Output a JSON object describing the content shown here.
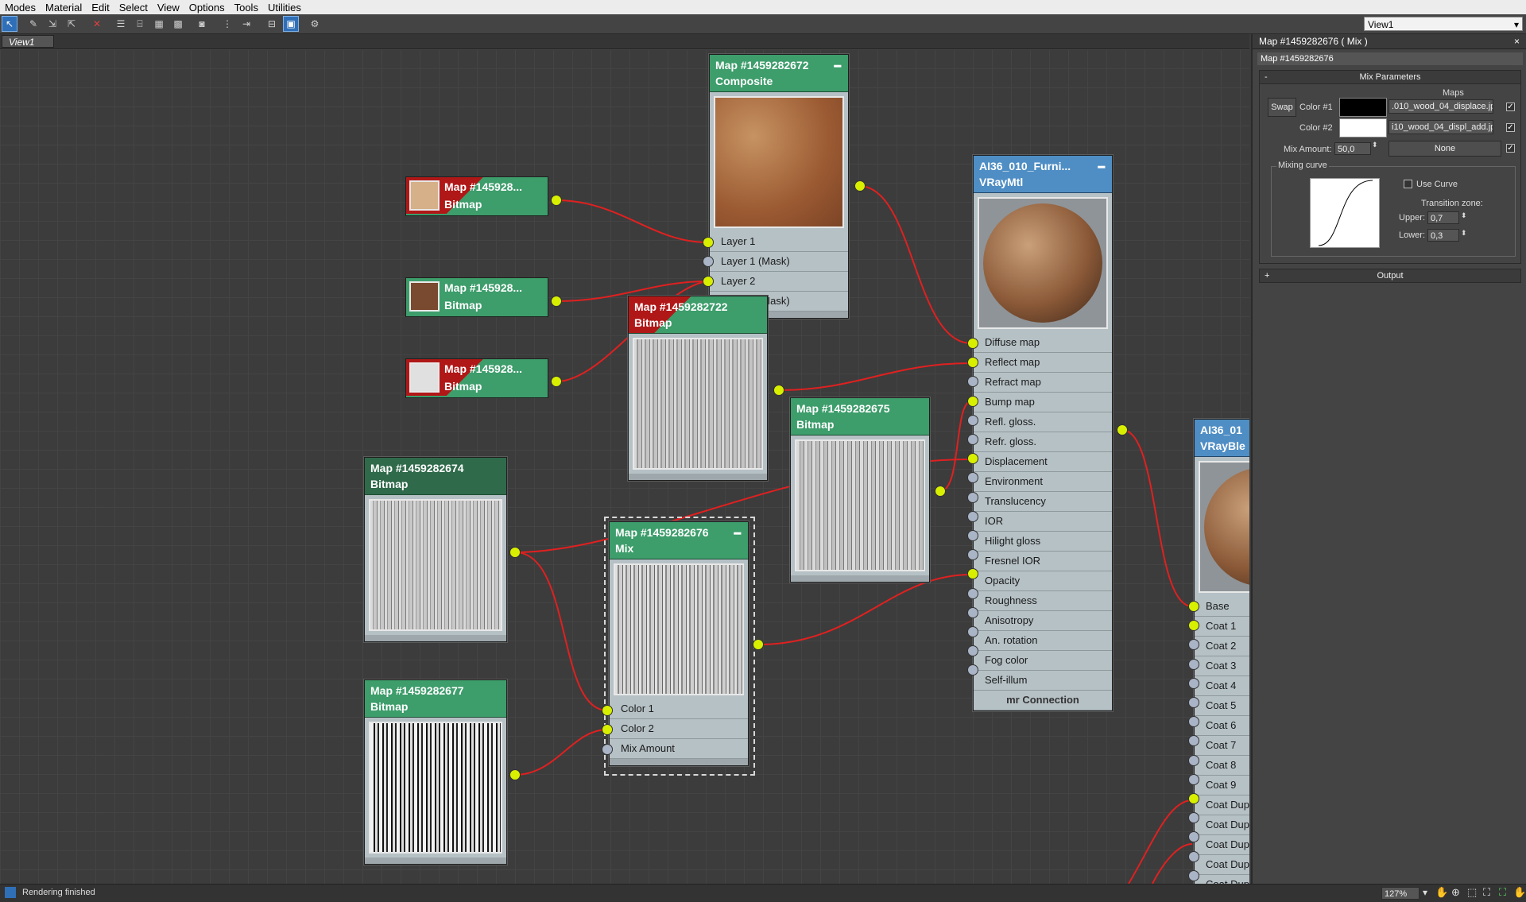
{
  "menu": [
    "Modes",
    "Material",
    "Edit",
    "Select",
    "View",
    "Options",
    "Tools",
    "Utilities"
  ],
  "toolbar": {
    "icons": [
      "select-icon",
      "paint-brush-icon",
      "assign-icon",
      "pick-material-icon",
      "delete-icon",
      "layout-icon",
      "layout-children-icon",
      "material-editor-icon",
      "show-map-icon",
      "show-background-icon",
      "show-end-result-icon",
      "move-children-icon",
      "hide-unused-icon",
      "lay-out-all-icon",
      "toggle-navigator-icon",
      "parameter-editor-icon"
    ]
  },
  "view_select": {
    "value": "View1"
  },
  "view_tab": {
    "label": "View1"
  },
  "colors": {
    "socket_on": "#d8f000",
    "wire": "#e02020",
    "node_green": "#3d9d6b",
    "node_blue": "#4f8ec4",
    "bitmap_red": "#b01818"
  },
  "nodes": {
    "composite": {
      "title": "Map #1459282672",
      "type": "Composite",
      "slots": [
        "Layer 1",
        "Layer 1 (Mask)",
        "Layer 2",
        "Layer 2 (Mask)"
      ]
    },
    "bm1": {
      "title": "Map  #145928...",
      "type": "Bitmap"
    },
    "bm2": {
      "title": "Map  #145928...",
      "type": "Bitmap"
    },
    "bm3": {
      "title": "Map  #145928...",
      "type": "Bitmap"
    },
    "bm722": {
      "title": "Map #1459282722",
      "type": "Bitmap"
    },
    "bm675": {
      "title": "Map #1459282675",
      "type": "Bitmap"
    },
    "bm674": {
      "title": "Map #1459282674",
      "type": "Bitmap"
    },
    "bm677": {
      "title": "Map #1459282677",
      "type": "Bitmap"
    },
    "mix": {
      "title": "Map #1459282676",
      "type": "Mix",
      "slots": [
        "Color 1",
        "Color 2",
        "Mix Amount"
      ]
    },
    "vraymtl": {
      "title": "AI36_010_Furni...",
      "type": "VRayMtl",
      "slots": [
        "Diffuse map",
        "Reflect map",
        "Refract map",
        "Bump map",
        "Refl. gloss.",
        "Refr. gloss.",
        "Displacement",
        "Environment",
        "Translucency",
        "IOR",
        "Hilight gloss",
        "Fresnel IOR",
        "Opacity",
        "Roughness",
        "Anisotropy",
        "An. rotation",
        "Fog color",
        "Self-illum"
      ],
      "footer": "mr Connection"
    },
    "vrayblend": {
      "title": "AI36_01",
      "type": "VRayBle",
      "slots": [
        "Base",
        "Coat 1",
        "Coat 2",
        "Coat 3",
        "Coat 4",
        "Coat 5",
        "Coat 6",
        "Coat 7",
        "Coat 8",
        "Coat 9",
        "Coat Dup",
        "Coat Dup",
        "Coat Dup",
        "Coat Dup",
        "Coat Dup"
      ]
    }
  },
  "panel": {
    "title": "Map #1459282676  ( Mix )",
    "name": "Map #1459282676",
    "mix_params": {
      "header": "Mix Parameters",
      "maps_label": "Maps",
      "swap": "Swap",
      "color1_label": "Color #1",
      "color1_map": ".010_wood_04_displace.jpg)",
      "color2_label": "Color #2",
      "color2_map": "i10_wood_04_displ_add.jpg)",
      "mix_amount_label": "Mix Amount:",
      "mix_amount": "50,0",
      "mix_map": "None",
      "mixing_curve": "Mixing curve",
      "use_curve": "Use Curve",
      "transition_zone": "Transition zone:",
      "upper_label": "Upper:",
      "upper": "0,7",
      "lower_label": "Lower:",
      "lower": "0,3"
    },
    "output": {
      "header": "Output"
    }
  },
  "status": {
    "text": "Rendering finished",
    "zoom": "127%"
  }
}
